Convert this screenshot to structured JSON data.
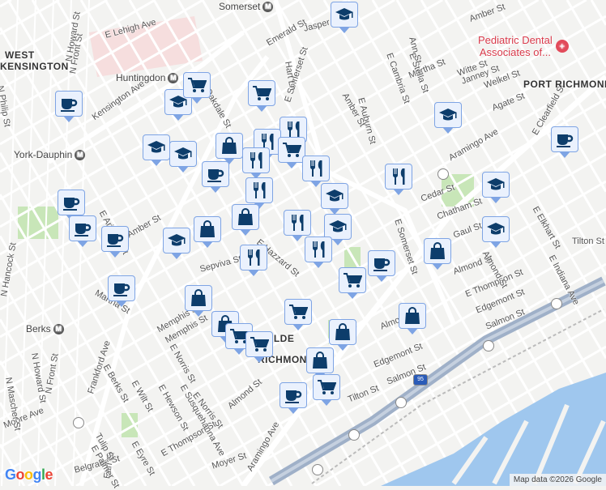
{
  "colors": {
    "water": "#9fc7ee",
    "park": "#c8e6b8",
    "highway": "#9fb0c8",
    "road": "#ffffff",
    "marker_glyph": "#0d3d6b",
    "poi": "#d93a4b"
  },
  "stations": [
    {
      "name": "Somerset",
      "icon": "metro-icon"
    },
    {
      "name": "Huntingdon",
      "icon": "metro-icon"
    },
    {
      "name": "York-Dauphin",
      "icon": "metro-icon"
    },
    {
      "name": "Berks",
      "icon": "metro-icon"
    }
  ],
  "areas": [
    "WEST",
    "KENSINGTON",
    "PORT RICHMOND",
    "OLDE",
    "RICHMOND"
  ],
  "poi": {
    "name_line1": "Pediatric Dental",
    "name_line2": "Associates of...",
    "icon": "dental-icon"
  },
  "streets": [
    "E Lehigh Ave",
    "Kensington Ave",
    "Frankford Ave",
    "N Front St",
    "Moore Ave",
    "E Somerset St",
    "Aramingo Ave",
    "E Cambria St",
    "Martha St",
    "Amber St",
    "Agate St",
    "Cedar St",
    "Chatham St",
    "Almond St",
    "E Thompson St",
    "Edgemont St",
    "Salmon St",
    "Tilton St",
    "E Indiana Ave",
    "Almond St",
    "Edgemont St",
    "Salmon St",
    "Tilton St",
    "Aramingo Ave",
    "Moyer St",
    "E Thompson St",
    "Almond St",
    "E Norris St",
    "Memphis St",
    "Sepviva St",
    "E Hazzard St",
    "Amber St",
    "E Arizona St",
    "Martha St",
    "N Hancock St",
    "N Mascher St",
    "N Howard St",
    "N Front St",
    "N Howard St",
    "N Philip St",
    "Belgrade St",
    "Earl St",
    "E Palmer St",
    "E Eyre St",
    "Tulip St",
    "E Berks St",
    "E Wilt St",
    "E Hewson St",
    "E Susquehanna Ave",
    "E Norris St",
    "Memphis St",
    "E Oakdale St",
    "Hart Ln",
    "Jasper St",
    "Witte St",
    "Janney St",
    "Welkel St",
    "E Stella St",
    "Ann St",
    "E Auburn St",
    "Amber St",
    "E Clearfield St",
    "E Elkhart St",
    "Gaul St",
    "E Somerset St",
    "Emerald St",
    "Almond St"
  ],
  "highways": [
    {
      "name": "I-95",
      "label": "95"
    }
  ],
  "markers": [
    "school",
    "school",
    "cart",
    "cart",
    "coffee",
    "restaurant",
    "school",
    "coffee",
    "school",
    "school",
    "bag",
    "restaurant",
    "cart",
    "restaurant",
    "coffee",
    "restaurant",
    "restaurant",
    "restaurant",
    "school",
    "coffee",
    "school",
    "bag",
    "bag",
    "restaurant",
    "school",
    "school",
    "coffee",
    "coffee",
    "school",
    "restaurant",
    "restaurant",
    "bag",
    "coffee",
    "cart",
    "coffee",
    "bag",
    "cart",
    "bag",
    "bag",
    "cart",
    "cart",
    "bag",
    "bag",
    "cart",
    "coffee"
  ],
  "footer": {
    "logo": "Google",
    "attribution": "Map data ©2026 Google"
  }
}
